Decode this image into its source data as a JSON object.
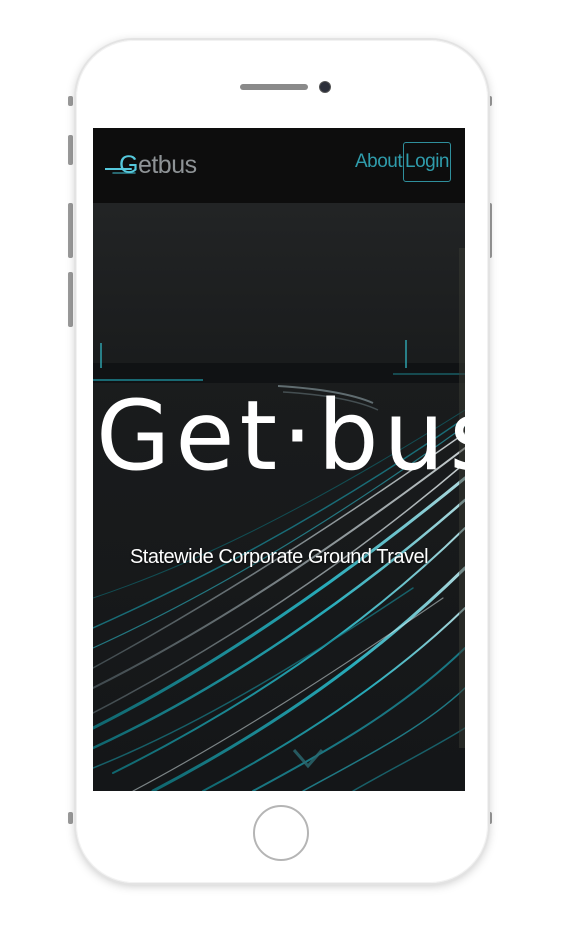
{
  "navbar": {
    "logo_first": "G",
    "logo_rest": "etbus",
    "about_label": "About",
    "login_label": "Login"
  },
  "hero": {
    "title": "Get·bus",
    "subtitle": "Statewide Corporate Ground Travel"
  },
  "colors": {
    "accent": "#2f9cab",
    "logo_accent": "#55c8dc",
    "nav_bg": "#0d0d0d",
    "hero_bg": "#1c1e20"
  },
  "icons": {
    "scroll": "chevron-down-icon",
    "logo": "swoosh-icon"
  }
}
